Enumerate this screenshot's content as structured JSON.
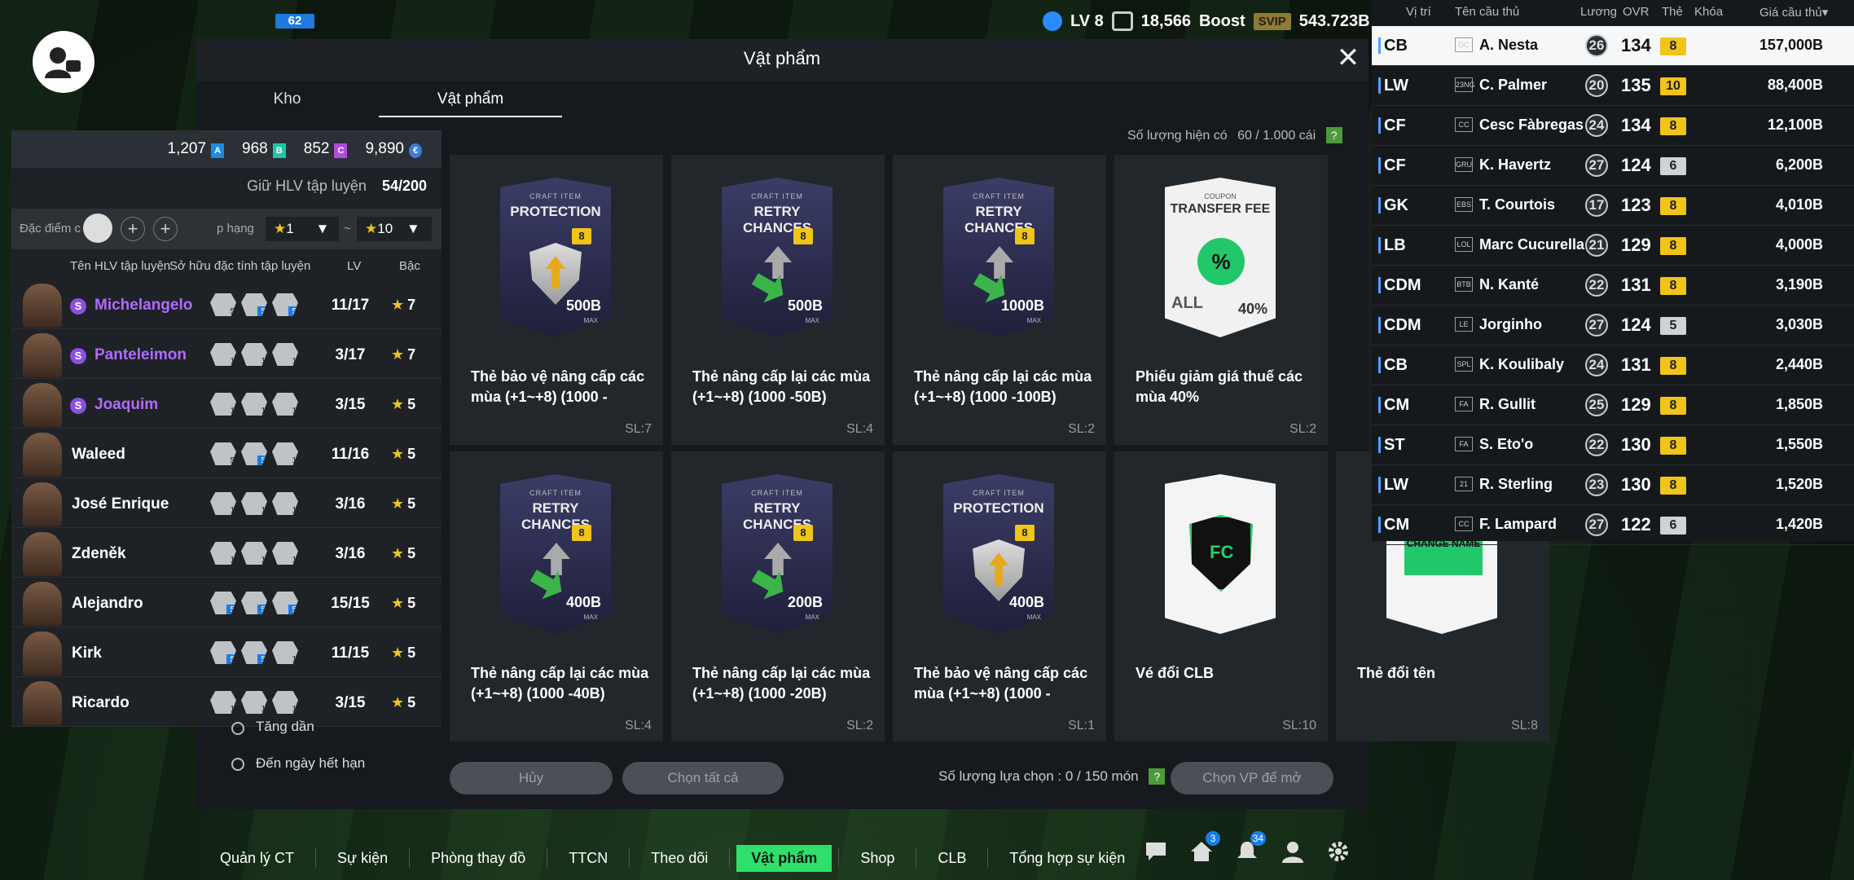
{
  "top": {
    "badge": "62",
    "level": "LV 8",
    "trophies": "18,566",
    "boost": "Boost",
    "svip": "SVIP",
    "coins": "543.723B"
  },
  "modal": {
    "title": "Vật phẩm",
    "close": "✕",
    "tabs": [
      "Kho",
      "Vật phẩm"
    ],
    "count_label": "Số lượng hiện có",
    "count_value": "60 / 1.000 cái",
    "help": "?"
  },
  "items": [
    {
      "kind": "craft",
      "label": "CRAFT ITEM",
      "name": "PROTECTION",
      "badge": "8",
      "value": "500B",
      "max": "MAX",
      "title": "Thẻ bảo vệ nâng cấp các mùa (+1~+8) (1000 -",
      "sl": "SL:7"
    },
    {
      "kind": "retry",
      "label": "CRAFT ITEM",
      "name": "RETRY CHANCES",
      "badge": "8",
      "value": "500B",
      "max": "MAX",
      "title": "Thẻ nâng cấp lại các mùa (+1~+8) (1000 -50B)",
      "sl": "SL:4"
    },
    {
      "kind": "retry",
      "label": "CRAFT ITEM",
      "name": "RETRY CHANCES",
      "badge": "8",
      "value": "1000B",
      "max": "MAX",
      "title": "Thẻ nâng cấp lại các mùa (+1~+8) (1000 -100B)",
      "sl": "SL:2"
    },
    {
      "kind": "coupon",
      "label": "COUPON",
      "name": "TRANSFER FEE",
      "circle": "%",
      "all": "ALL",
      "pct": "40%",
      "title": "Phiếu giảm giá thuế các mùa 40%",
      "sl": "SL:2"
    },
    {
      "kind": "retry",
      "label": "CRAFT ITEM",
      "name": "RETRY CHANCES",
      "badge": "8",
      "value": "400B",
      "max": "MAX",
      "title": "Thẻ nâng cấp lại các mùa (+1~+8) (1000 -40B)",
      "sl": "SL:4"
    },
    {
      "kind": "retry",
      "label": "CRAFT ITEM",
      "name": "RETRY CHANCES",
      "badge": "8",
      "value": "200B",
      "max": "MAX",
      "title": "Thẻ nâng cấp lại các mùa (+1~+8) (1000 -20B)",
      "sl": "SL:2"
    },
    {
      "kind": "craft",
      "label": "CRAFT ITEM",
      "name": "PROTECTION",
      "badge": "8",
      "value": "400B",
      "max": "MAX",
      "title": "Thẻ bảo vệ nâng cấp các mùa (+1~+8) (1000 -",
      "sl": "SL:1"
    },
    {
      "kind": "club",
      "title": "Vé đổi CLB",
      "sl": "SL:10"
    },
    {
      "kind": "namechange",
      "tag": "CHANGE NAME",
      "title": "Thẻ đổi tên",
      "sl": "SL:8"
    }
  ],
  "buttons": {
    "cancel": "Hủy",
    "select_all": "Chọn tất cả",
    "select_count_label": "Số lượng lựa chọn : 0 / 150 món",
    "open": "Chọn VP để mở"
  },
  "left": {
    "currencies": [
      {
        "v": "1,207",
        "c": "A",
        "color": "#1c8be6"
      },
      {
        "v": "968",
        "c": "B",
        "color": "#1ec6a6"
      },
      {
        "v": "852",
        "c": "C",
        "color": "#b04be0"
      },
      {
        "v": "9,890",
        "c": "€",
        "color": "#3c7ae0"
      }
    ],
    "hold_label": "Giữ HLV tập luyện",
    "hold_value": "54/200",
    "filter_label": "Đặc điểm c",
    "grade_label": "p hạng",
    "from": "1",
    "to": "10",
    "tilde": "~",
    "col_name": "Tên HLV tập luyện",
    "col_traits": "Sở hữu đặc tính tập luyện",
    "col_lv": "LV",
    "col_grade": "Bậc",
    "coaches": [
      {
        "name": "Michelangelo",
        "s": true,
        "lv": "11/17",
        "grade": "7",
        "traits": [
          {
            "n": "5"
          },
          {
            "n": "5",
            "b": true
          },
          {
            "n": "5",
            "b": true
          }
        ]
      },
      {
        "name": "Panteleimon",
        "s": true,
        "lv": "3/17",
        "grade": "7",
        "traits": [
          {
            "n": "1"
          },
          {
            "n": "1"
          },
          {
            "n": "1"
          }
        ]
      },
      {
        "name": "Joaquim",
        "s": true,
        "lv": "3/15",
        "grade": "5",
        "traits": [
          {
            "n": "1"
          },
          {
            "n": "1"
          },
          {
            "n": "1"
          }
        ]
      },
      {
        "name": "Waleed",
        "s": false,
        "lv": "11/16",
        "grade": "5",
        "traits": [
          {
            "n": "5"
          },
          {
            "n": "5",
            "b": true
          },
          {
            "n": "1"
          }
        ]
      },
      {
        "name": "José Enrique",
        "s": false,
        "lv": "3/16",
        "grade": "5",
        "traits": [
          {
            "n": "1"
          },
          {
            "n": "1"
          },
          {
            "n": "1"
          }
        ]
      },
      {
        "name": "Zdeněk",
        "s": false,
        "lv": "3/16",
        "grade": "5",
        "traits": [
          {
            "n": "1"
          },
          {
            "n": "1"
          },
          {
            "n": "1"
          }
        ]
      },
      {
        "name": "Alejandro",
        "s": false,
        "lv": "15/15",
        "grade": "5",
        "traits": [
          {
            "n": "5",
            "b": true
          },
          {
            "n": "5",
            "b": true
          },
          {
            "n": "5",
            "b": true
          }
        ]
      },
      {
        "name": "Kirk",
        "s": false,
        "lv": "11/15",
        "grade": "5",
        "traits": [
          {
            "n": "5",
            "b": true
          },
          {
            "n": "5",
            "b": true
          },
          {
            "n": "1"
          }
        ]
      },
      {
        "name": "Ricardo",
        "s": false,
        "lv": "3/15",
        "grade": "5",
        "traits": [
          {
            "n": "1"
          },
          {
            "n": "1"
          },
          {
            "n": "1"
          }
        ]
      }
    ],
    "sort_opt1": "Tăng dần",
    "sort_opt2": "Đến ngày hết hạn"
  },
  "right": {
    "cols": {
      "pos": "Vị trí",
      "name": "Tên cầu thủ",
      "salary": "Lương",
      "ovr": "OVR",
      "card": "Thẻ",
      "lock": "Khóa",
      "price": "Giá cầu thủ▾"
    },
    "players": [
      {
        "pos": "CB",
        "team": "DC",
        "name": "A. Nesta",
        "age": "26",
        "ovr": "134",
        "card": "8",
        "price": "157,000B"
      },
      {
        "pos": "LW",
        "team": "23NG",
        "name": "C. Palmer",
        "age": "20",
        "ovr": "135",
        "card": "10",
        "price": "88,400B"
      },
      {
        "pos": "CF",
        "team": "CC",
        "name": "Cesc Fàbregas",
        "age": "24",
        "ovr": "134",
        "card": "8",
        "price": "12,100B"
      },
      {
        "pos": "CF",
        "team": "GRU",
        "name": "K. Havertz",
        "age": "27",
        "ovr": "124",
        "card": "6",
        "price": "6,200B"
      },
      {
        "pos": "GK",
        "team": "EBS",
        "name": "T. Courtois",
        "age": "17",
        "ovr": "123",
        "card": "8",
        "price": "4,010B"
      },
      {
        "pos": "LB",
        "team": "LOL",
        "name": "Marc Cucurella",
        "age": "21",
        "ovr": "129",
        "card": "8",
        "price": "4,000B"
      },
      {
        "pos": "CDM",
        "team": "BTB",
        "name": "N. Kanté",
        "age": "22",
        "ovr": "131",
        "card": "8",
        "price": "3,190B"
      },
      {
        "pos": "CDM",
        "team": "LE",
        "name": "Jorginho",
        "age": "27",
        "ovr": "124",
        "card": "5",
        "price": "3,030B"
      },
      {
        "pos": "CB",
        "team": "SPL",
        "name": "K. Koulibaly",
        "age": "24",
        "ovr": "131",
        "card": "8",
        "price": "2,440B"
      },
      {
        "pos": "CM",
        "team": "FA",
        "name": "R. Gullit",
        "age": "25",
        "ovr": "129",
        "card": "8",
        "price": "1,850B"
      },
      {
        "pos": "ST",
        "team": "FA",
        "name": "S. Eto'o",
        "age": "22",
        "ovr": "130",
        "card": "8",
        "price": "1,550B"
      },
      {
        "pos": "LW",
        "team": "21",
        "name": "R. Sterling",
        "age": "23",
        "ovr": "130",
        "card": "8",
        "price": "1,520B"
      },
      {
        "pos": "CM",
        "team": "CC",
        "name": "F. Lampard",
        "age": "27",
        "ovr": "122",
        "card": "6",
        "price": "1,420B"
      }
    ]
  },
  "nav": {
    "items": [
      "Quản lý CT",
      "Sự kiện",
      "Phòng thay đồ",
      "TTCN",
      "Theo dõi",
      "Vật phẩm",
      "Shop",
      "CLB",
      "Tổng hợp sự kiện"
    ],
    "active": "Vật phẩm",
    "badge_home": "3",
    "badge_bell": "34"
  },
  "colors": {
    "accent": "#2ee06b",
    "gold": "#f0c419",
    "purple": "#b06bff"
  }
}
